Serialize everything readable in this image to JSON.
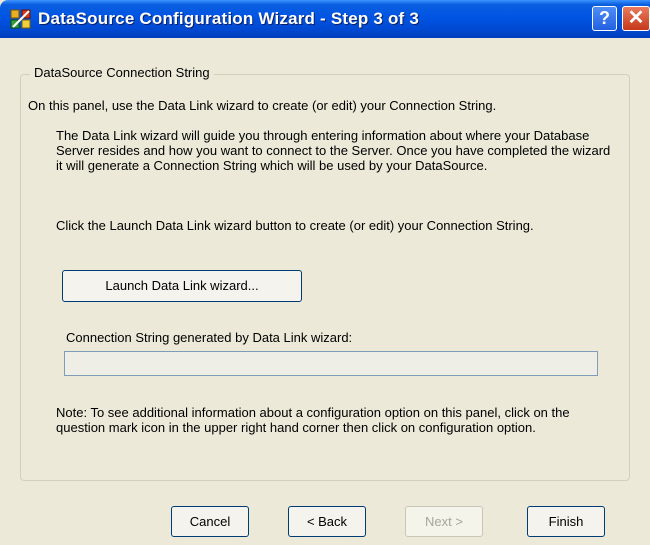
{
  "window": {
    "title": "DataSource Configuration Wizard - Step 3 of 3",
    "help_glyph": "?",
    "close_glyph": "✕"
  },
  "group": {
    "legend": "DataSource Connection String",
    "intro": "On this panel, use the Data Link wizard to create (or edit) your Connection String.",
    "para1": "The Data Link wizard will guide you through entering information about where your Database Server resides and how you want to connect to the Server. Once you have completed the wizard it will generate a Connection String which will be used by your DataSource.",
    "para2": "Click the Launch Data Link wizard button to create (or edit) your Connection String.",
    "launch_button": "Launch Data Link wizard...",
    "connection_label": "Connection String generated by Data Link wizard:",
    "connection_value": "",
    "note": "Note: To see additional information about a configuration option on this panel, click on the question mark icon in the upper right hand corner then click on configuration option."
  },
  "footer": {
    "cancel": "Cancel",
    "back": "< Back",
    "next": "Next >",
    "finish": "Finish"
  }
}
